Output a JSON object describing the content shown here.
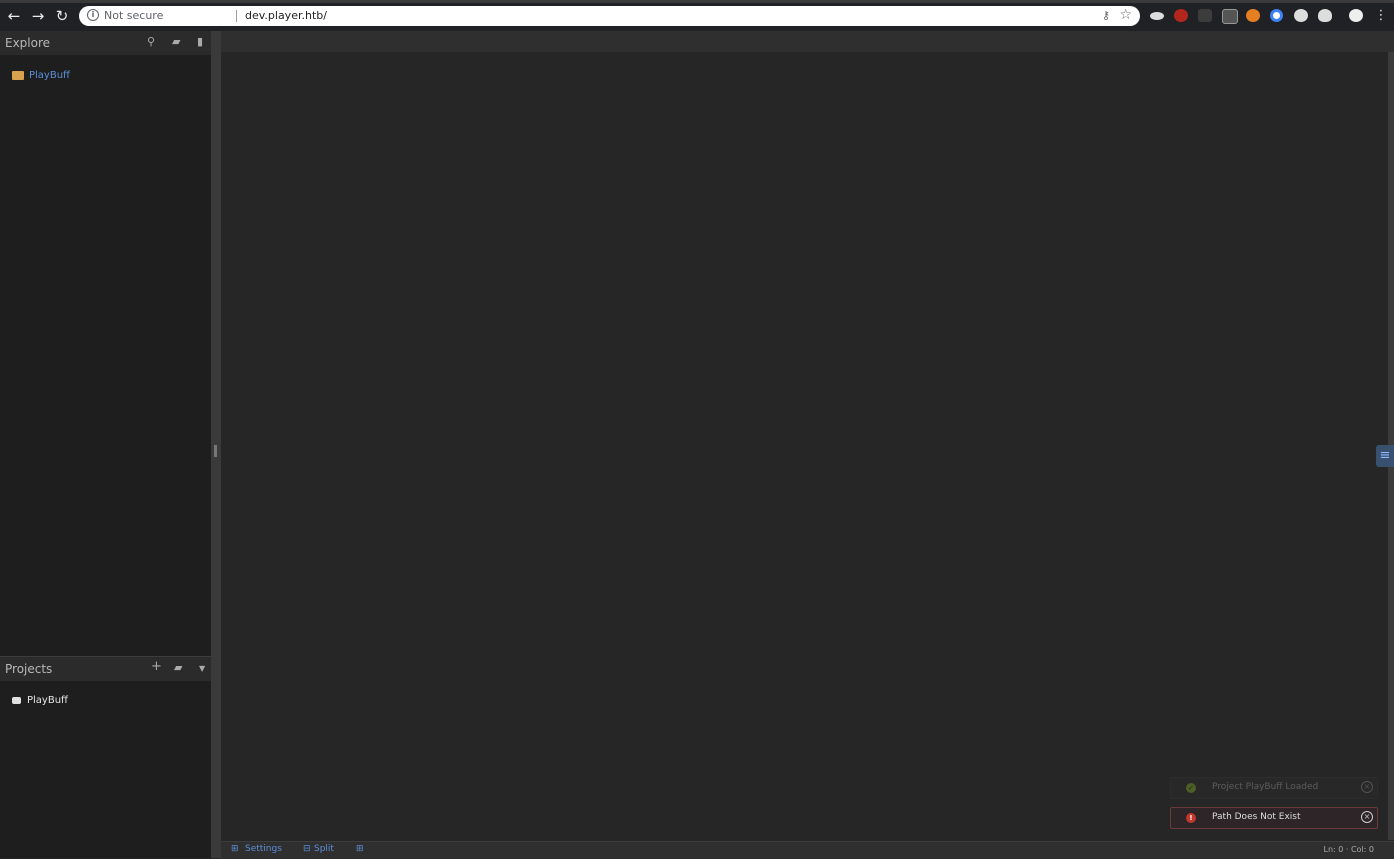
{
  "browser": {
    "security_label": "Not secure",
    "url": "dev.player.htb/"
  },
  "explore": {
    "title": "Explore",
    "items": [
      {
        "label": "PlayBuff"
      }
    ]
  },
  "projects": {
    "title": "Projects",
    "add_label": "+",
    "items": [
      {
        "label": "PlayBuff"
      }
    ]
  },
  "notifications": [
    {
      "text": "Project PlayBuff Loaded",
      "status": "success",
      "color": "#6b8e23"
    },
    {
      "text": "Path Does Not Exist",
      "status": "error",
      "color": "#c0392b"
    }
  ],
  "statusbar": {
    "settings_label": "Settings",
    "split_label": "Split",
    "position": "Ln: 0 · Col: 0"
  },
  "colors": {
    "accent": "#5b8fd9",
    "folder": "#d7a14d"
  }
}
